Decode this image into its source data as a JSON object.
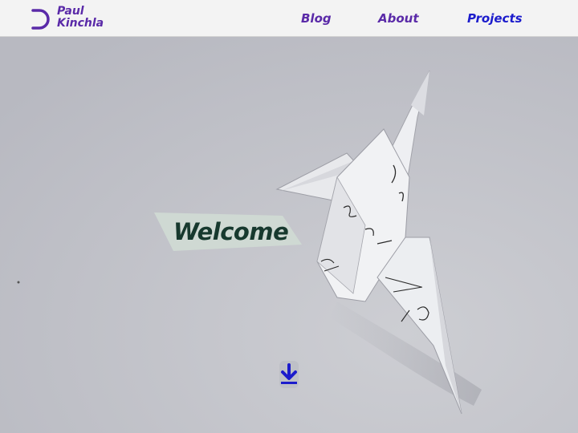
{
  "brand": {
    "line1": "Paul",
    "line2": "Kinchla",
    "color": "#5a2aa8"
  },
  "nav": {
    "blog_label": "Blog",
    "about_label": "About",
    "projects_label": "Projects",
    "link_color": "#5a2aa8",
    "active_color": "#1c1ccc"
  },
  "hero": {
    "image": "origami-crane-photo",
    "welcome_label": "Welcome",
    "scroll_icon": "arrow-down-icon"
  }
}
